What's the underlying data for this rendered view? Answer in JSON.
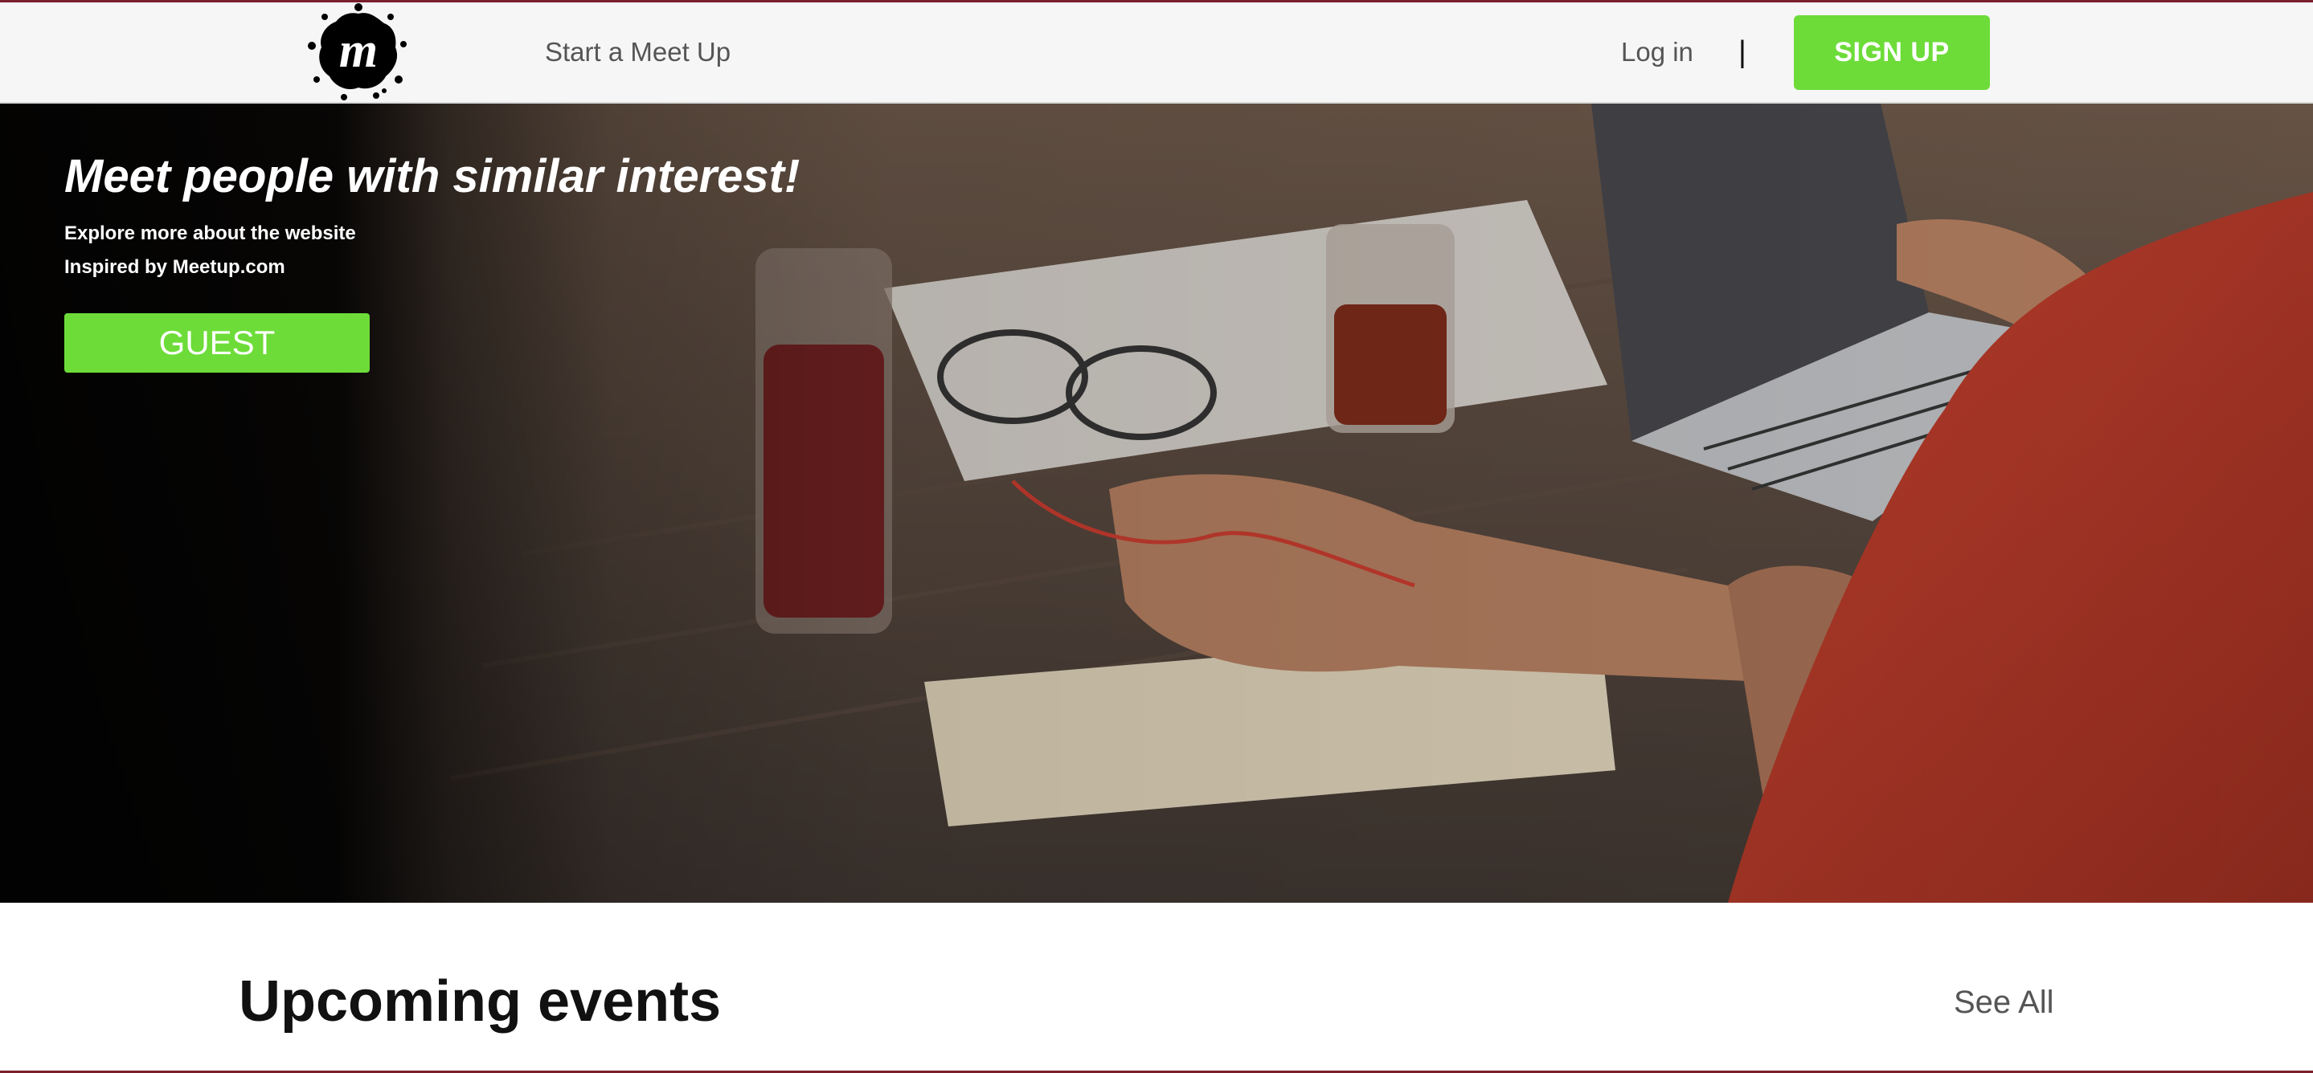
{
  "header": {
    "logo_icon": "meetup-logo-icon",
    "nav_start": "Start a Meet Up",
    "nav_login": "Log in",
    "separator": "|",
    "signup_label": "SIGN UP"
  },
  "hero": {
    "title": "Meet people with similar interest!",
    "line1": "Explore more about the website",
    "line2": "Inspired by Meetup.com",
    "guest_label": "GUEST",
    "background_icon": "workspace-photo"
  },
  "events": {
    "title": "Upcoming events",
    "see_all": "See All"
  },
  "colors": {
    "accent": "#6ddc39",
    "header_bg": "#f6f6f6",
    "frame": "#7a1f2b"
  }
}
